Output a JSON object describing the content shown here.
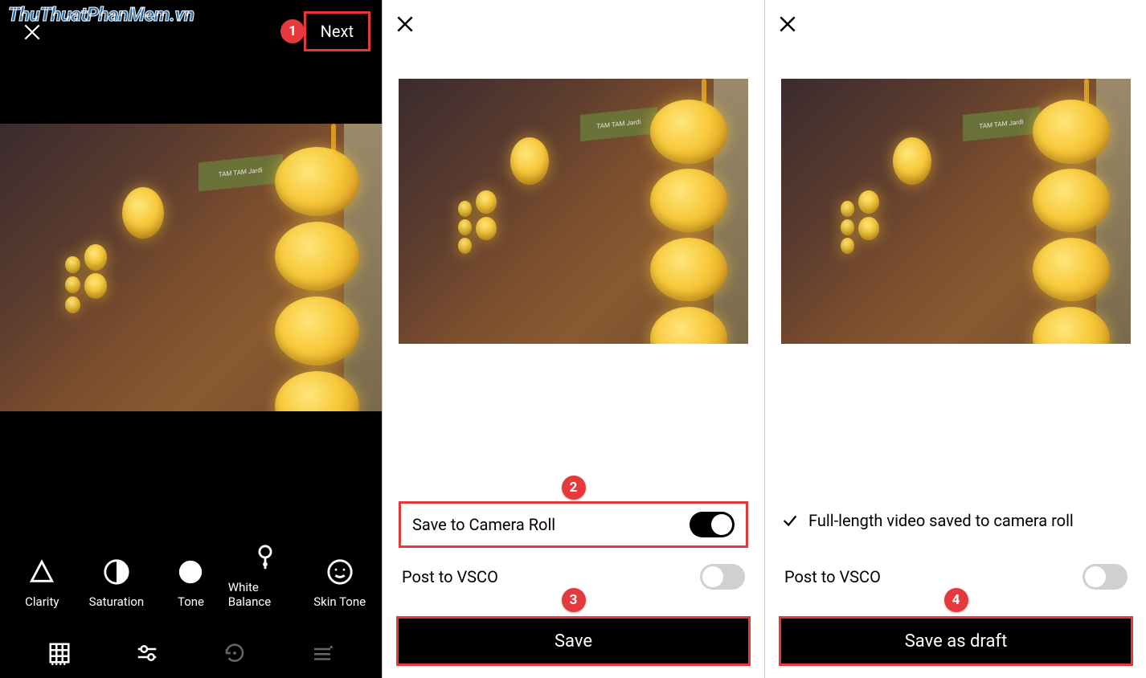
{
  "watermark": "ThuThuatPhanMem.vn",
  "panel1": {
    "next_label": "Next",
    "badge": "1",
    "sign_text": "TAM TAM Jardi",
    "tools": [
      {
        "name": "clarity-tool",
        "label": "Clarity"
      },
      {
        "name": "saturation-tool",
        "label": "Saturation"
      },
      {
        "name": "tone-tool",
        "label": "Tone"
      },
      {
        "name": "white-balance-tool",
        "label": "White Balance"
      },
      {
        "name": "skin-tone-tool",
        "label": "Skin Tone"
      }
    ]
  },
  "panel2": {
    "badge_top": "2",
    "save_camera_roll_label": "Save to Camera Roll",
    "save_camera_roll_on": true,
    "post_vsco_label": "Post to VSCO",
    "post_vsco_on": false,
    "badge_bottom": "3",
    "save_label": "Save"
  },
  "panel3": {
    "confirm_label": "Full-length video saved to camera roll",
    "post_vsco_label": "Post to VSCO",
    "post_vsco_on": false,
    "badge": "4",
    "save_draft_label": "Save as draft"
  }
}
